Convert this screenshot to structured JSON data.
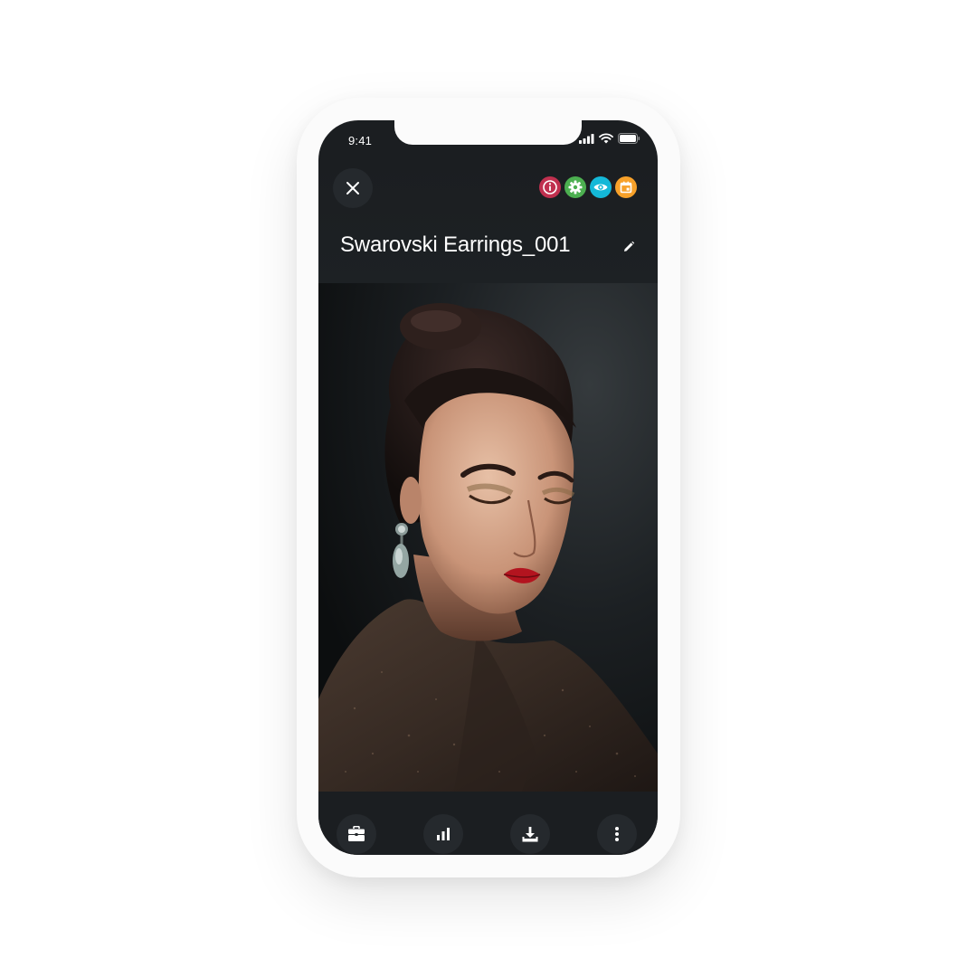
{
  "status_bar": {
    "time": "9:41",
    "icons": [
      "cellular-signal-icon",
      "wifi-icon",
      "battery-icon"
    ]
  },
  "header": {
    "close_icon": "close-icon",
    "title": "Swarovski Earrings_001",
    "edit_icon": "pencil-icon",
    "badges": [
      {
        "icon": "info-icon",
        "color": "#c0304f"
      },
      {
        "icon": "gear-icon",
        "color": "#4caf50"
      },
      {
        "icon": "eye-icon",
        "color": "#14b8d8"
      },
      {
        "icon": "calendar-icon",
        "color": "#f7a12a"
      }
    ]
  },
  "photo": {
    "subject": "portrait-photo"
  },
  "toolbar": {
    "items": [
      {
        "icon": "briefcase-icon"
      },
      {
        "icon": "bar-chart-icon"
      },
      {
        "icon": "download-icon"
      },
      {
        "icon": "more-vertical-icon"
      }
    ]
  },
  "colors": {
    "screen_background": "#1b1e21",
    "button_background": "#25292d",
    "text": "#ffffff"
  }
}
